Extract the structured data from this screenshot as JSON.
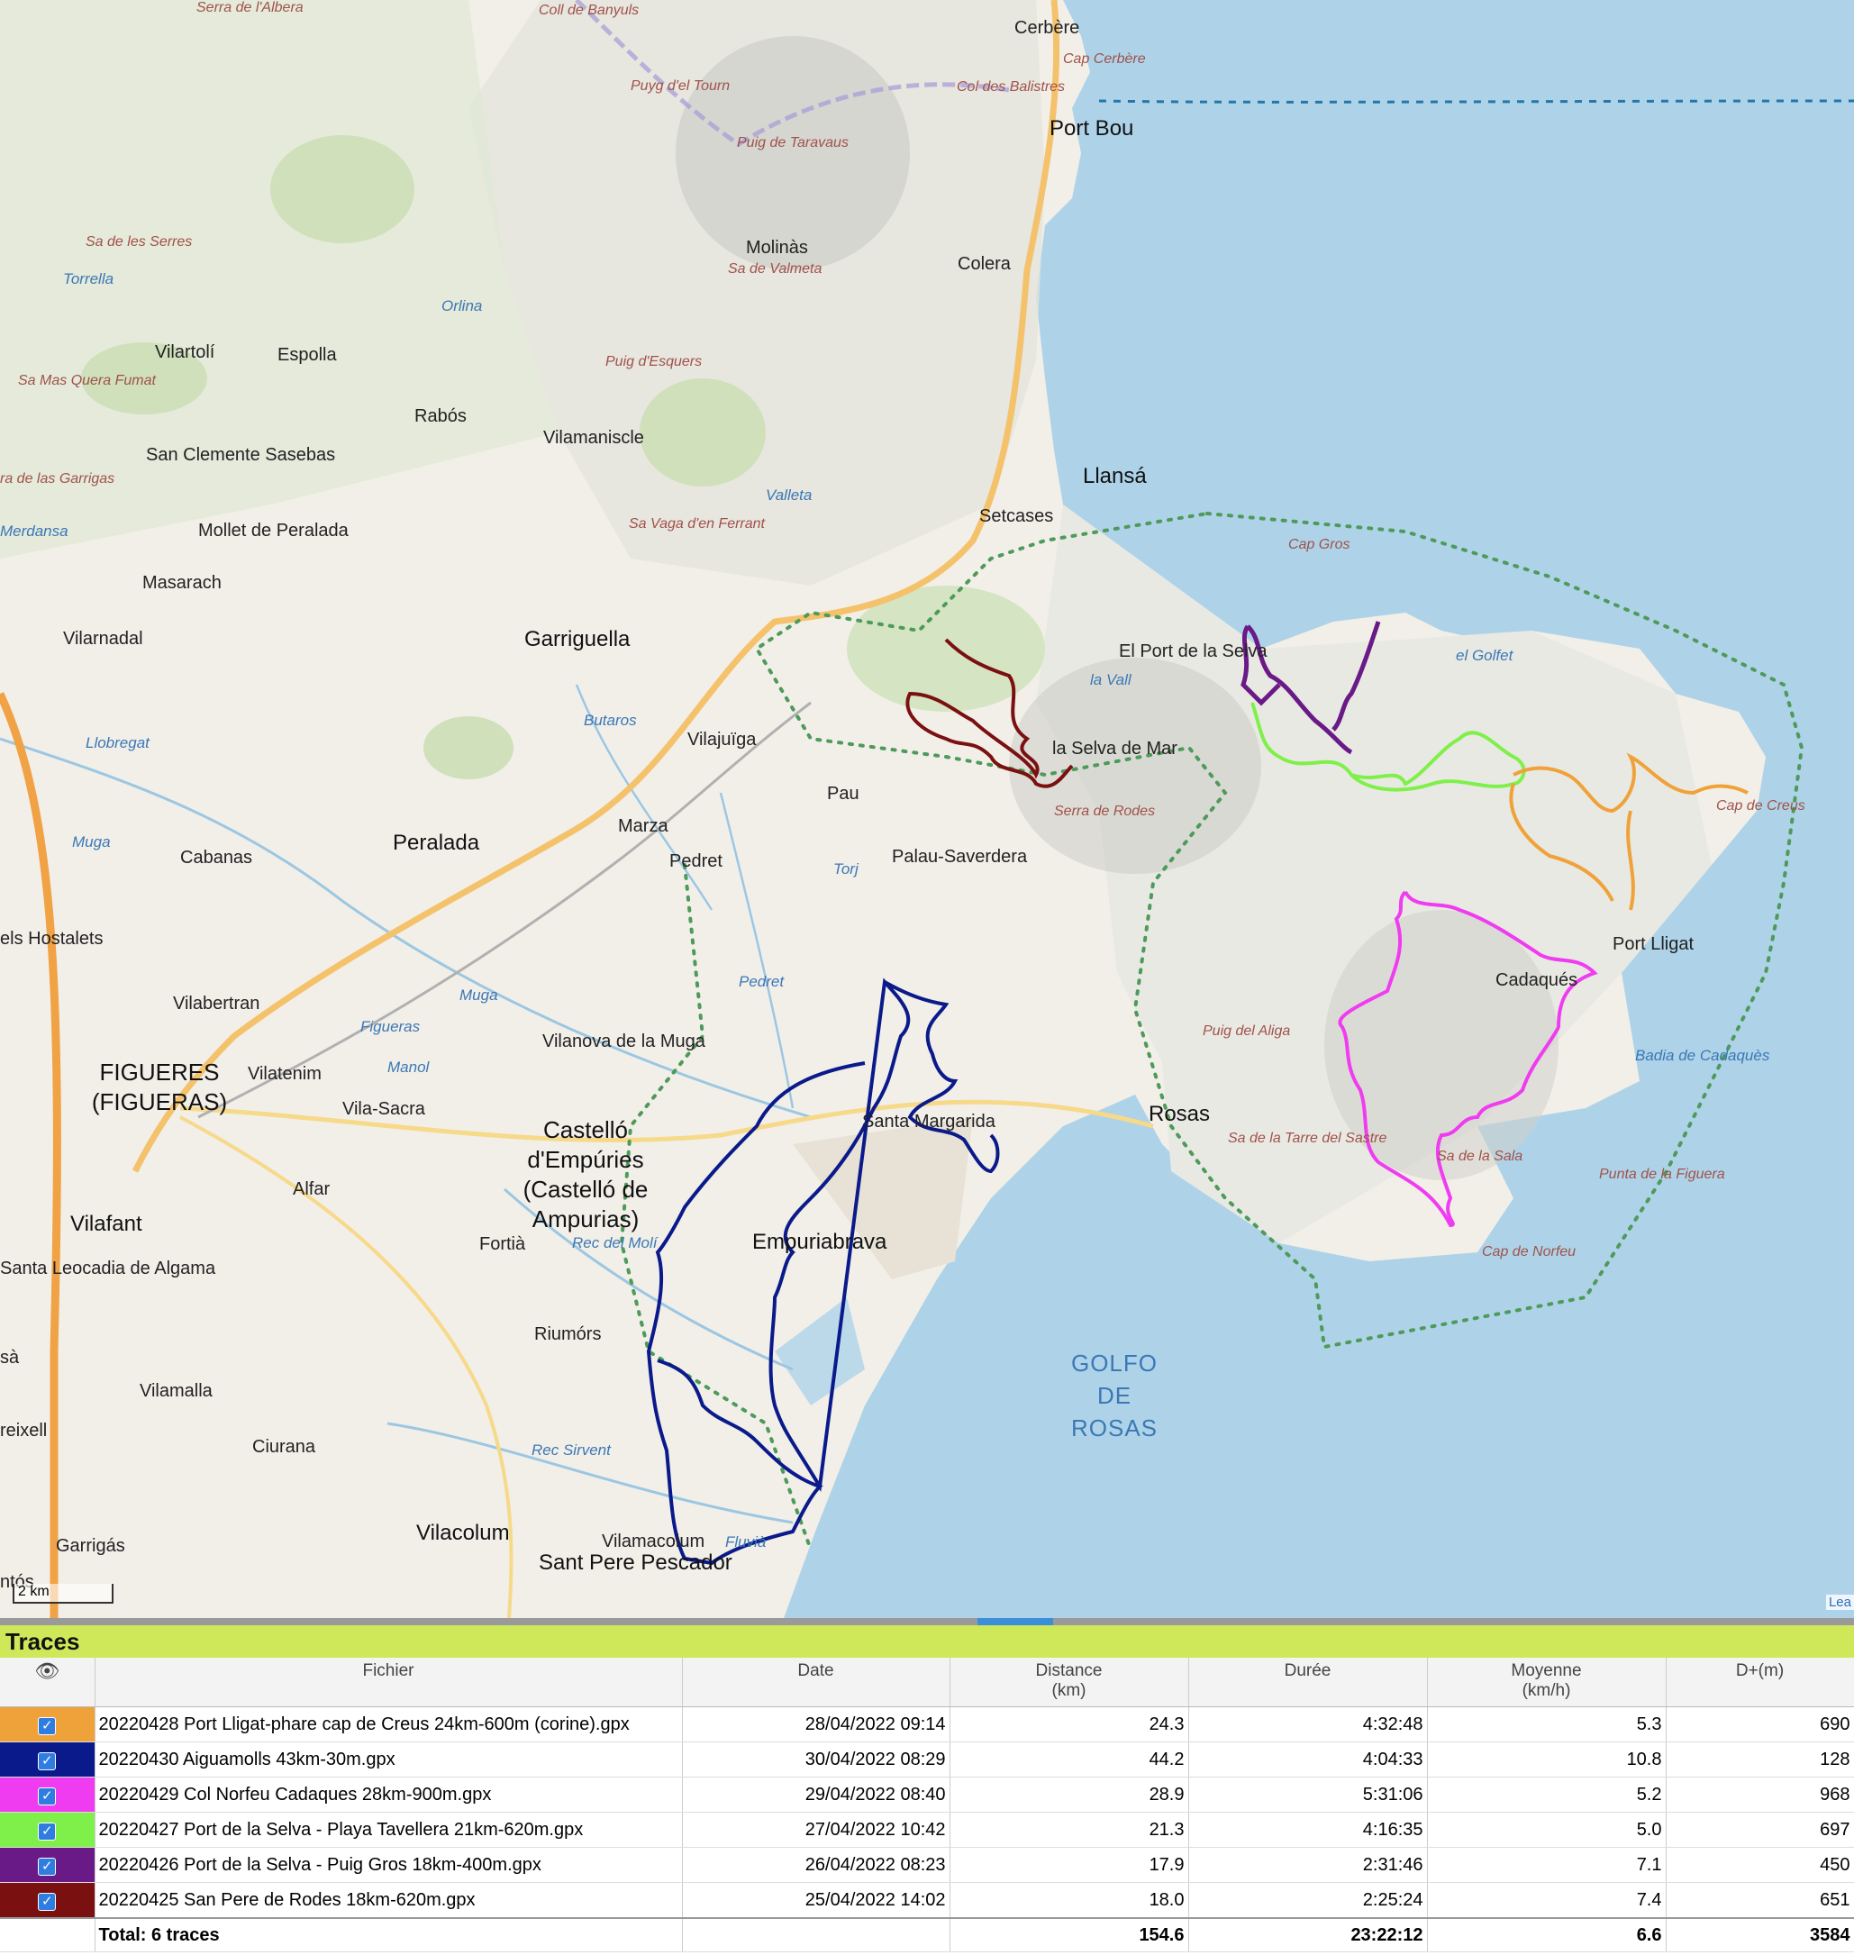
{
  "map": {
    "scale_label": "2 km",
    "attribution": "Lea",
    "places": [
      {
        "name": "Serra de l'Albera",
        "kind": "hill"
      },
      {
        "name": "Coll de Banyuls",
        "kind": "hill"
      },
      {
        "name": "Cerbère",
        "kind": "town"
      },
      {
        "name": "Cap Cerbère",
        "kind": "hill"
      },
      {
        "name": "Puyg d'el Tourn",
        "kind": "hill"
      },
      {
        "name": "Col des Balistres",
        "kind": "hill"
      },
      {
        "name": "Port Bou",
        "kind": "big"
      },
      {
        "name": "Puig de Taravaus",
        "kind": "hill"
      },
      {
        "name": "Molinàs",
        "kind": "town"
      },
      {
        "name": "Colera",
        "kind": "town"
      },
      {
        "name": "Sa de Valmeta",
        "kind": "hill"
      },
      {
        "name": "Sa de les Serres",
        "kind": "hill"
      },
      {
        "name": "Torrella",
        "kind": "water"
      },
      {
        "name": "Vilartolí",
        "kind": "town"
      },
      {
        "name": "Espolla",
        "kind": "town"
      },
      {
        "name": "Orlina",
        "kind": "water"
      },
      {
        "name": "Puig d'Esquers",
        "kind": "hill"
      },
      {
        "name": "Sa Mas Quera Fumat",
        "kind": "hill"
      },
      {
        "name": "Rabós",
        "kind": "town"
      },
      {
        "name": "Vilamaniscle",
        "kind": "town"
      },
      {
        "name": "San Clemente Sasebas",
        "kind": "town"
      },
      {
        "name": "ra de las Garrigas",
        "kind": "hill"
      },
      {
        "name": "Llansá",
        "kind": "big"
      },
      {
        "name": "Setcases",
        "kind": "town"
      },
      {
        "name": "Sa Vaga d'en Ferrant",
        "kind": "hill"
      },
      {
        "name": "Valleta",
        "kind": "water"
      },
      {
        "name": "Mollet de Peralada",
        "kind": "town"
      },
      {
        "name": "Cap Gros",
        "kind": "hill"
      },
      {
        "name": "Masarach",
        "kind": "town"
      },
      {
        "name": "Merdansa",
        "kind": "water"
      },
      {
        "name": "Vilarnadal",
        "kind": "town"
      },
      {
        "name": "Garriguella",
        "kind": "big"
      },
      {
        "name": "El Port de la Selva",
        "kind": "town"
      },
      {
        "name": "el Golfet",
        "kind": "water"
      },
      {
        "name": "la Vall",
        "kind": "water"
      },
      {
        "name": "Butaros",
        "kind": "water"
      },
      {
        "name": "Llobregat",
        "kind": "water"
      },
      {
        "name": "Vilajuïga",
        "kind": "town"
      },
      {
        "name": "la Selva de Mar",
        "kind": "town"
      },
      {
        "name": "Pau",
        "kind": "town"
      },
      {
        "name": "Serra de Rodes",
        "kind": "hill"
      },
      {
        "name": "Cap de Creus",
        "kind": "hill"
      },
      {
        "name": "Muga",
        "kind": "water"
      },
      {
        "name": "Cabanas",
        "kind": "town"
      },
      {
        "name": "Peralada",
        "kind": "big"
      },
      {
        "name": "Marza",
        "kind": "town"
      },
      {
        "name": "Pedret",
        "kind": "town"
      },
      {
        "name": "Torj",
        "kind": "water"
      },
      {
        "name": "Palau-Saverdera",
        "kind": "town"
      },
      {
        "name": "els Hostalets",
        "kind": "town"
      },
      {
        "name": "Port Lligat",
        "kind": "town"
      },
      {
        "name": "Cadaqués",
        "kind": "town"
      },
      {
        "name": "Vilabertran",
        "kind": "town"
      },
      {
        "name": "Pedret",
        "kind": "water"
      },
      {
        "name": "Muga",
        "kind": "water"
      },
      {
        "name": "Figueras",
        "kind": "water"
      },
      {
        "name": "Vilanova de la Muga",
        "kind": "town"
      },
      {
        "name": "Puig del Aliga",
        "kind": "hill"
      },
      {
        "name": "Badia de Cadaquès",
        "kind": "water"
      },
      {
        "name": "Manol",
        "kind": "water"
      },
      {
        "name": "Vilatenim",
        "kind": "town"
      },
      {
        "name": "Vila-Sacra",
        "kind": "town"
      },
      {
        "name": "Rosas",
        "kind": "big"
      },
      {
        "name": "Castelló d'Empúries (Castelló de Ampurias)",
        "kind": "city"
      },
      {
        "name": "Santa Margarida",
        "kind": "town"
      },
      {
        "name": "Sa de la Tarre del Sastre",
        "kind": "hill"
      },
      {
        "name": "Sa de la Sala",
        "kind": "hill"
      },
      {
        "name": "Punta de la Figuera",
        "kind": "hill"
      },
      {
        "name": "Alfar",
        "kind": "town"
      },
      {
        "name": "Vilafant",
        "kind": "big"
      },
      {
        "name": "Fortià",
        "kind": "town"
      },
      {
        "name": "Rec del Molí",
        "kind": "water"
      },
      {
        "name": "Empuriabrava",
        "kind": "big"
      },
      {
        "name": "Cap de Norfeu",
        "kind": "hill"
      },
      {
        "name": "Santa Leocadia de Algama",
        "kind": "town"
      },
      {
        "name": "Riumórs",
        "kind": "town"
      },
      {
        "name": "GOLFO DE ROSAS",
        "kind": "sea"
      },
      {
        "name": "sà",
        "kind": "town"
      },
      {
        "name": "Vilamalla",
        "kind": "town"
      },
      {
        "name": "reixell",
        "kind": "town"
      },
      {
        "name": "Ciurana",
        "kind": "town"
      },
      {
        "name": "Rec Sirvent",
        "kind": "water"
      },
      {
        "name": "Vilacolum",
        "kind": "big"
      },
      {
        "name": "Vilamacolum",
        "kind": "town"
      },
      {
        "name": "Garrigás",
        "kind": "town"
      },
      {
        "name": "Sant Pere Pescador",
        "kind": "big"
      },
      {
        "name": "Fluvià",
        "kind": "water"
      },
      {
        "name": "ntós",
        "kind": "town"
      },
      {
        "name": "FIGUERES (FIGUERAS)",
        "kind": "city"
      }
    ]
  },
  "panel": {
    "title": "Traces",
    "columns": {
      "visible_icon": "eye-icon",
      "file": "Fichier",
      "date": "Date",
      "distance": "Distance",
      "distance_unit": "(km)",
      "duration": "Durée",
      "average": "Moyenne",
      "average_unit": "(km/h)",
      "climb": "D+(m)"
    },
    "rows": [
      {
        "color": "#f0a23a",
        "checked": true,
        "file": "20220428 Port Lligat-phare cap de Creus 24km-600m (corine).gpx",
        "date": "28/04/2022 09:14",
        "distance": "24.3",
        "duration": "4:32:48",
        "average": "5.3",
        "climb": "690"
      },
      {
        "color": "#0a1a8a",
        "checked": true,
        "file": "20220430 Aiguamolls 43km-30m.gpx",
        "date": "30/04/2022 08:29",
        "distance": "44.2",
        "duration": "4:04:33",
        "average": "10.8",
        "climb": "128"
      },
      {
        "color": "#f03cf0",
        "checked": true,
        "file": "20220429 Col Norfeu Cadaques 28km-900m.gpx",
        "date": "29/04/2022 08:40",
        "distance": "28.9",
        "duration": "5:31:06",
        "average": "5.2",
        "climb": "968"
      },
      {
        "color": "#7ff04a",
        "checked": true,
        "file": "20220427 Port de la Selva - Playa Tavellera 21km-620m.gpx",
        "date": "27/04/2022 10:42",
        "distance": "21.3",
        "duration": "4:16:35",
        "average": "5.0",
        "climb": "697"
      },
      {
        "color": "#6a1a86",
        "checked": true,
        "file": "20220426 Port de la Selva - Puig Gros 18km-400m.gpx",
        "date": "26/04/2022 08:23",
        "distance": "17.9",
        "duration": "2:31:46",
        "average": "7.1",
        "climb": "450"
      },
      {
        "color": "#7a1010",
        "checked": true,
        "file": "20220425 San Pere de Rodes 18km-620m.gpx",
        "date": "25/04/2022 14:02",
        "distance": "18.0",
        "duration": "2:25:24",
        "average": "7.4",
        "climb": "651"
      }
    ],
    "total": {
      "label": "Total: 6 traces",
      "distance": "154.6",
      "duration": "23:22:12",
      "average": "6.6",
      "climb": "3584"
    }
  }
}
